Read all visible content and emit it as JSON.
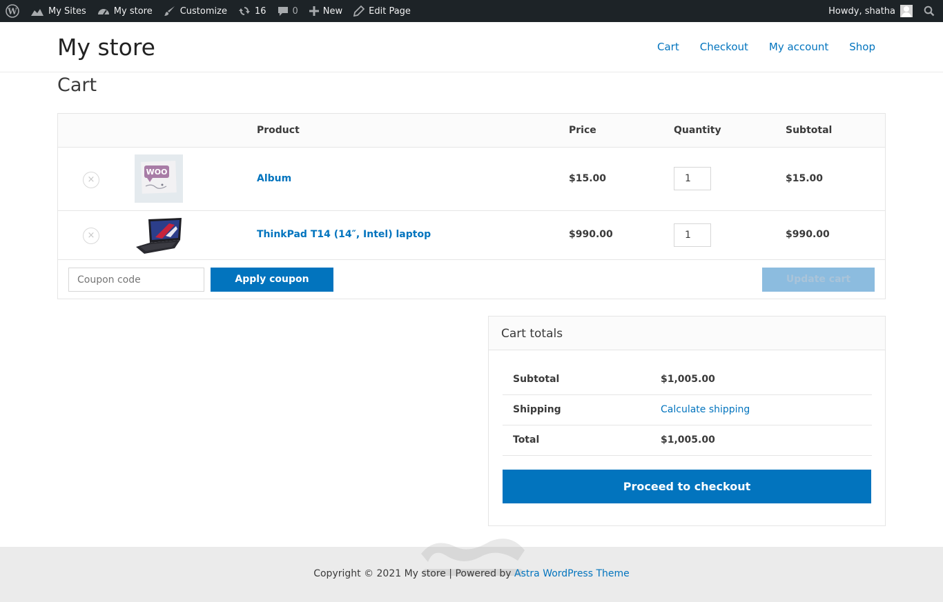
{
  "adminbar": {
    "my_sites": "My Sites",
    "my_store": "My store",
    "customize": "Customize",
    "updates_count": "16",
    "comments_count": "0",
    "new": "New",
    "edit_page": "Edit Page",
    "howdy": "Howdy, shatha"
  },
  "header": {
    "site_title": "My store",
    "nav": [
      "Cart",
      "Checkout",
      "My account",
      "Shop"
    ]
  },
  "page": {
    "title": "Cart"
  },
  "cart": {
    "columns": {
      "product": "Product",
      "price": "Price",
      "quantity": "Quantity",
      "subtotal": "Subtotal"
    },
    "items": [
      {
        "name": "Album",
        "price": "$15.00",
        "quantity": "1",
        "subtotal": "$15.00"
      },
      {
        "name": "ThinkPad T14 (14″, Intel) laptop",
        "price": "$990.00",
        "quantity": "1",
        "subtotal": "$990.00"
      }
    ],
    "remove_symbol": "×",
    "coupon_placeholder": "Coupon code",
    "apply_coupon": "Apply coupon",
    "update_cart": "Update cart"
  },
  "totals": {
    "heading": "Cart totals",
    "rows": [
      {
        "label": "Subtotal",
        "value": "$1,005.00"
      },
      {
        "label": "Shipping",
        "value": "Calculate shipping"
      },
      {
        "label": "Total",
        "value": "$1,005.00"
      }
    ],
    "checkout_button": "Proceed to checkout"
  },
  "footer": {
    "text": "Copyright © 2021 My store | Powered by",
    "link": "Astra WordPress Theme"
  },
  "colors": {
    "accent": "#0274be",
    "adminbar": "#1d2327"
  }
}
